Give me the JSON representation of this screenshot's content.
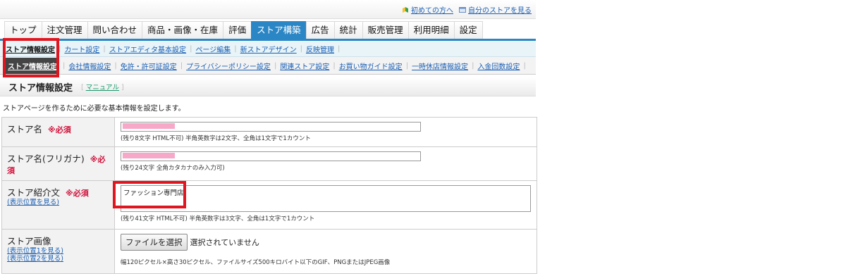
{
  "toplinks": [
    {
      "icon": "beginner-icon",
      "label": "初めての方へ",
      "color": "#3aa14a"
    },
    {
      "icon": "window-icon",
      "label": "自分のストアを見る",
      "color": "#6a8ec7"
    }
  ],
  "tabs": [
    "トップ",
    "注文管理",
    "問い合わせ",
    "商品・画像・在庫",
    "評価",
    "ストア構築",
    "広告",
    "統計",
    "販売管理",
    "利用明細",
    "設定"
  ],
  "active_tab": "ストア構築",
  "subnav1": [
    "ストア情報設定",
    "カート設定",
    "ストアエディタ基本設定",
    "ページ編集",
    "新ストアデザイン",
    "反映管理"
  ],
  "subnav2": [
    "ストア情報設定",
    "会社情報設定",
    "免許・許可証設定",
    "プライバシーポリシー設定",
    "関連ストア設定",
    "お買い物ガイド設定",
    "一時休店情報設定",
    "入金回数設定"
  ],
  "page": {
    "title": "ストア情報設定",
    "manual": "マニュアル",
    "description": "ストアページを作るために必要な基本情報を設定します。"
  },
  "form": {
    "required_label": "※必須",
    "store_name": {
      "label": "ストア名",
      "note": "(残り8文字 HTML不可) 半角英数字は2文字、全角は1文字で1カウント"
    },
    "store_kana": {
      "label": "ストア名(フリガナ)",
      "note": "(残り24文字 全角カタカナのみ入力可)"
    },
    "store_intro": {
      "label": "ストア紹介文",
      "link": "(表示位置を見る)",
      "value": "ファッション専門店",
      "note": "(残り41文字 HTML不可) 半角英数字は3文字、全角は1文字で1カウント"
    },
    "store_image": {
      "label": "ストア画像",
      "link1": "(表示位置1を見る)",
      "link2": "(表示位置2を見る)",
      "button": "ファイルを選択",
      "status": "選択されていません",
      "note": "幅120ピクセル×高さ30ピクセル、ファイルサイズ500キロバイト以下のGIF、PNGまたはJPEG画像"
    }
  },
  "colors": {
    "accent": "#2b86c5",
    "required": "#d0103a",
    "highlight": "#e0151f",
    "mask": "#f7a8c8"
  }
}
